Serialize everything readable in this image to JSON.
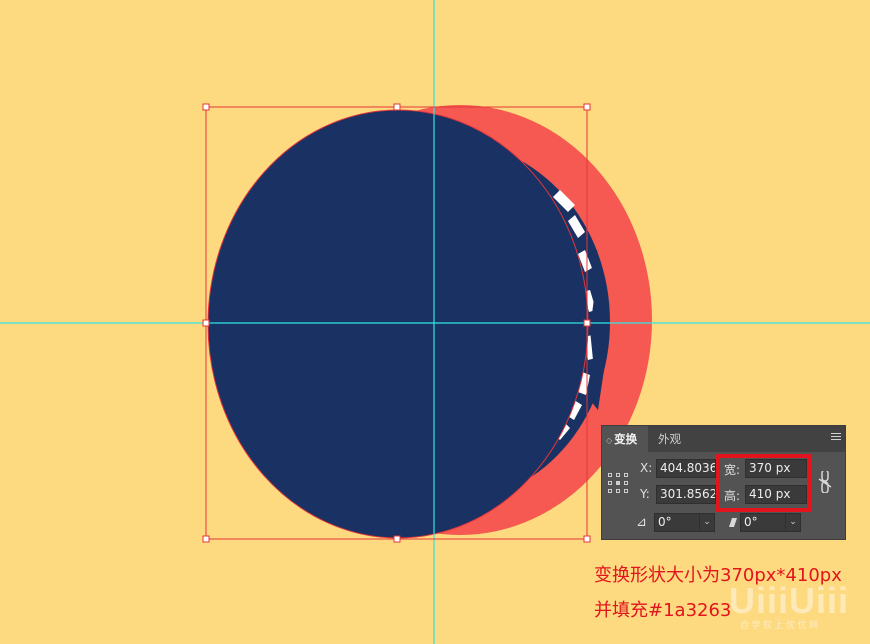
{
  "colors": {
    "background": "#fdd97f",
    "circle_fill": "#1a3263",
    "back_circle": "#f55951",
    "guide": "#2ee6e6",
    "selection": "#e2363a",
    "annotation": "#e2141e"
  },
  "panel": {
    "tabs": [
      {
        "label": "变换",
        "active": true
      },
      {
        "label": "外观",
        "active": false
      }
    ],
    "x_label": "X:",
    "x_value": "404.8036",
    "y_label": "Y:",
    "y_value": "301.8562",
    "width_label": "宽:",
    "width_value": "370 px",
    "height_label": "高:",
    "height_value": "410 px",
    "rotate_value": "0°",
    "shear_value": "0°",
    "icons": [
      "reference-point-icon",
      "constrain-proportions-icon",
      "rotate-angle-icon",
      "shear-icon",
      "panel-menu-icon"
    ]
  },
  "annotation": {
    "line1": "变换形状大小为370px*410px",
    "line2": "并填充#1a3263"
  },
  "watermark": {
    "logo": "UiiiUiii",
    "tagline": "自 学 就 上 优 优 网"
  }
}
